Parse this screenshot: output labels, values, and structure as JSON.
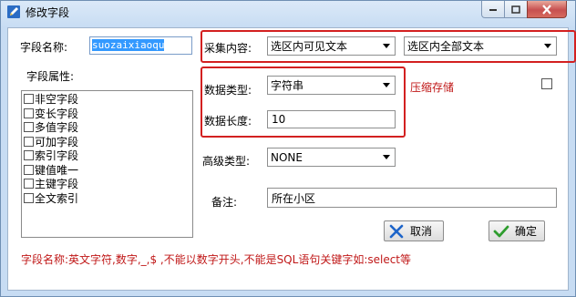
{
  "window": {
    "title": "修改字段"
  },
  "form": {
    "field_name_label": "字段名称:",
    "field_name_value": "suozaixiaoqu",
    "attributes_label": "字段属性:",
    "attributes": [
      "非空字段",
      "变长字段",
      "多值字段",
      "可加字段",
      "索引字段",
      "键值唯一",
      "主键字段",
      "全文索引"
    ],
    "collect_label": "采集内容:",
    "collect_option1": "选区内可见文本",
    "collect_option2": "选区内全部文本",
    "data_type_label": "数据类型:",
    "data_type_value": "字符串",
    "data_length_label": "数据长度:",
    "data_length_value": "10",
    "compress_label": "压缩存储",
    "advanced_type_label": "高级类型:",
    "advanced_type_value": "NONE",
    "note_label": "备注:",
    "note_value": "所在小区",
    "hint": "字段名称:英文字符,数字,_,$ ,不能以数字开头,不能是SQL语句关键字如:select等"
  },
  "buttons": {
    "cancel": "取消",
    "ok": "确定"
  },
  "colors": {
    "highlight": "#d32020",
    "hint": "#c01818",
    "selection": "#3399ff"
  }
}
